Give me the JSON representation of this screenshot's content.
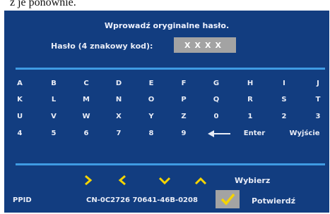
{
  "document": {
    "partial_line": "z je ponownie."
  },
  "dialog": {
    "title": "Wprowadź oryginalne hasło.",
    "password_label": "Hasło (4 znakowy kod):",
    "password_value": "XXXX"
  },
  "keyboard": {
    "rows": [
      [
        "A",
        "B",
        "C",
        "D",
        "E",
        "F",
        "G",
        "H",
        "I",
        "J"
      ],
      [
        "K",
        "L",
        "M",
        "N",
        "O",
        "P",
        "Q",
        "R",
        "S",
        "T"
      ],
      [
        "U",
        "V",
        "W",
        "X",
        "Y",
        "Z",
        "0",
        "1",
        "2",
        "3"
      ],
      [
        "4",
        "5",
        "6",
        "7",
        "8",
        "9"
      ]
    ],
    "backspace_icon": "left-arrow-icon",
    "enter_label": "Enter",
    "exit_label": "Wyjście"
  },
  "navigation": {
    "icons": [
      "right-chevron-icon",
      "left-chevron-icon",
      "down-chevron-icon",
      "up-chevron-icon"
    ],
    "select_label": "Wybierz"
  },
  "footer": {
    "ppid_label": "PPID",
    "ppid_value": "CN-0C2726 70641-46B-0208",
    "confirm_label": "Potwierdź",
    "confirm_icon": "checkmark-icon"
  },
  "colors": {
    "panel": "#123d80",
    "rule": "#3f9be3",
    "highlight": "#f5d400",
    "box": "#a3a3a3"
  }
}
